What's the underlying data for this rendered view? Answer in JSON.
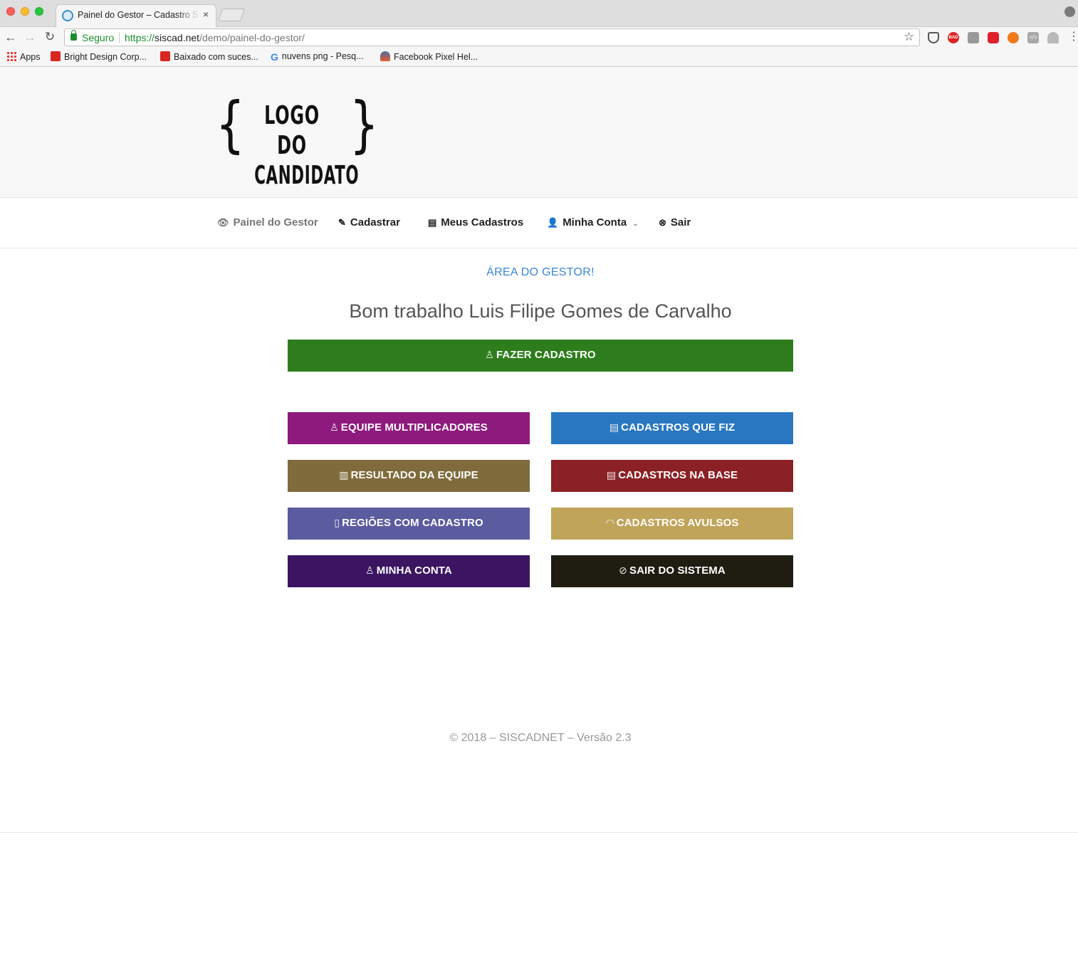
{
  "browser": {
    "tab_title": "Painel do Gestor – Cadastro Si",
    "tab_close": "×",
    "secure_label": "Seguro",
    "url_scheme": "https://",
    "url_host": "siscad.net",
    "url_path": "/demo/painel-do-gestor/",
    "bookmarks": [
      {
        "label": "Apps",
        "icon": "apps-grid-icon"
      },
      {
        "label": "Bright Design Corp...",
        "icon": "bookmark-red-icon"
      },
      {
        "label": "Baixado com suces...",
        "icon": "bookmark-red-icon"
      },
      {
        "label": "nuvens png - Pesq...",
        "icon": "google-icon"
      },
      {
        "label": "Facebook Pixel Hel...",
        "icon": "facebook-pixel-icon"
      }
    ],
    "extensions": [
      {
        "icon": "shield-icon"
      },
      {
        "icon": "adblock-icon",
        "label": "BAD"
      },
      {
        "icon": "camera-icon"
      },
      {
        "icon": "youtube-icon"
      },
      {
        "icon": "extension-orange-icon"
      },
      {
        "icon": "code-icon",
        "label": "</>"
      },
      {
        "icon": "download-icon"
      }
    ]
  },
  "header": {
    "logo": {
      "line1": "LOGO DO",
      "line2": "CANDIDATO"
    }
  },
  "nav": {
    "items": [
      {
        "label": "Painel do Gestor",
        "icon": "eye-icon"
      },
      {
        "label": "Cadastrar",
        "icon": "edit-icon"
      },
      {
        "label": "Meus Cadastros",
        "icon": "document-icon"
      },
      {
        "label": "Minha Conta",
        "icon": "user-icon",
        "dropdown": true
      },
      {
        "label": "Sair",
        "icon": "close-circle-icon"
      }
    ]
  },
  "main": {
    "area_title": "ÁREA DO GESTOR!",
    "welcome": "Bom trabalho Luis Filipe Gomes de Carvalho",
    "primary_button": {
      "label": "FAZER CADASTRO",
      "icon": "user-icon",
      "color": "#2e7d1c"
    },
    "buttons": [
      {
        "label": "EQUIPE MULTIPLICADORES",
        "icon": "users-icon",
        "color": "#8e1a7d"
      },
      {
        "label": "CADASTROS QUE FIZ",
        "icon": "documents-icon",
        "color": "#2977c0"
      },
      {
        "label": "RESULTADO DA EQUIPE",
        "icon": "bar-chart-icon",
        "color": "#7f6b3c"
      },
      {
        "label": "CADASTROS NA BASE",
        "icon": "list-icon",
        "color": "#8b2126"
      },
      {
        "label": "REGIÕES COM CADASTRO",
        "icon": "map-icon",
        "color": "#5b5ba0"
      },
      {
        "label": "CADASTROS AVULSOS",
        "icon": "ghost-icon",
        "color": "#bfa45a"
      },
      {
        "label": "MINHA CONTA",
        "icon": "user-icon",
        "color": "#3b1562"
      },
      {
        "label": "SAIR DO SISTEMA",
        "icon": "ban-icon",
        "color": "#1f1c12"
      }
    ]
  },
  "footer": {
    "text": "© 2018 – SISCADNET – Versão 2.3"
  }
}
